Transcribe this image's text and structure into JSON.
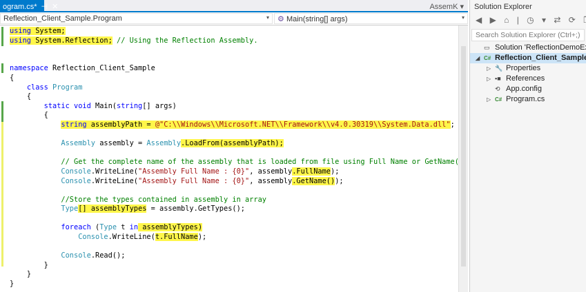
{
  "tab": {
    "title": "ogram.cs*",
    "pin": "⊣",
    "close": "✕",
    "overflow_label": "AssemK ▾"
  },
  "nav": {
    "type_combo": "Reflection_Client_Sample.Program",
    "member_combo": "Main(string[] args)",
    "arrow": "▾",
    "member_icon": "⚙"
  },
  "code": [
    {
      "i": 0,
      "s": [
        {
          "t": "using",
          "c": "kw",
          "h": 1
        },
        {
          "t": " System;",
          "c": "pl",
          "h": 1
        }
      ]
    },
    {
      "i": 0,
      "s": [
        {
          "t": "using",
          "c": "kw",
          "h": 1
        },
        {
          "t": " System.Reflection;",
          "c": "pl",
          "h": 1
        },
        {
          "t": " // Using the Reflection Assembly.",
          "c": "cm"
        }
      ]
    },
    {
      "i": 0,
      "s": []
    },
    {
      "i": 0,
      "s": []
    },
    {
      "i": 0,
      "s": [
        {
          "t": "namespace",
          "c": "kw"
        },
        {
          "t": " Reflection_Client_Sample",
          "c": "pl"
        }
      ]
    },
    {
      "i": 0,
      "s": [
        {
          "t": "{",
          "c": "pl"
        }
      ]
    },
    {
      "i": 4,
      "s": [
        {
          "t": "class",
          "c": "kw"
        },
        {
          "t": " Program",
          "c": "ty"
        }
      ]
    },
    {
      "i": 4,
      "s": [
        {
          "t": "{",
          "c": "pl"
        }
      ]
    },
    {
      "i": 8,
      "s": [
        {
          "t": "static void",
          "c": "kw"
        },
        {
          "t": " Main(",
          "c": "pl"
        },
        {
          "t": "string",
          "c": "kw"
        },
        {
          "t": "[] args)",
          "c": "pl"
        }
      ]
    },
    {
      "i": 8,
      "s": [
        {
          "t": "{",
          "c": "pl"
        }
      ]
    },
    {
      "i": 12,
      "s": [
        {
          "t": "string",
          "c": "kw",
          "h": 1
        },
        {
          "t": " assemblyPath = ",
          "c": "pl",
          "h": 1
        },
        {
          "t": "@\"C:\\\\Windows\\\\Microsoft.NET\\\\Framework\\\\v4.0.30319\\\\System.Data.dll\"",
          "c": "st",
          "h": 1
        },
        {
          "t": ";",
          "c": "pl"
        }
      ]
    },
    {
      "i": 0,
      "s": []
    },
    {
      "i": 12,
      "s": [
        {
          "t": "Assembly",
          "c": "ty"
        },
        {
          "t": " assembly = ",
          "c": "pl"
        },
        {
          "t": "Assembly",
          "c": "ty"
        },
        {
          "t": ".LoadFrom(assemblyPath);",
          "c": "pl",
          "h": 1
        }
      ]
    },
    {
      "i": 0,
      "s": []
    },
    {
      "i": 12,
      "s": [
        {
          "t": "// Get the complete name of the assembly that is loaded from file using Full Name or GetName()",
          "c": "cm"
        }
      ]
    },
    {
      "i": 12,
      "s": [
        {
          "t": "Console",
          "c": "ty"
        },
        {
          "t": ".WriteLine(",
          "c": "pl"
        },
        {
          "t": "\"Assembly Full Name : {0}\"",
          "c": "st"
        },
        {
          "t": ", assembly",
          "c": "pl"
        },
        {
          "t": ".FullName",
          "c": "pl",
          "h": 1
        },
        {
          "t": ");",
          "c": "pl"
        }
      ]
    },
    {
      "i": 12,
      "s": [
        {
          "t": "Console",
          "c": "ty"
        },
        {
          "t": ".WriteLine(",
          "c": "pl"
        },
        {
          "t": "\"Assembly Full Name : {0}\"",
          "c": "st"
        },
        {
          "t": ", assembly",
          "c": "pl"
        },
        {
          "t": ".GetName()",
          "c": "pl",
          "h": 1
        },
        {
          "t": ");",
          "c": "pl"
        }
      ]
    },
    {
      "i": 0,
      "s": []
    },
    {
      "i": 12,
      "s": [
        {
          "t": "//Store the types contained in assembly in array",
          "c": "cm"
        }
      ]
    },
    {
      "i": 12,
      "s": [
        {
          "t": "Type",
          "c": "ty"
        },
        {
          "t": "[] assemblyTypes",
          "c": "pl",
          "h": 1
        },
        {
          "t": " = assembly.GetTypes();",
          "c": "pl"
        }
      ]
    },
    {
      "i": 0,
      "s": []
    },
    {
      "i": 12,
      "s": [
        {
          "t": "foreach",
          "c": "kw"
        },
        {
          "t": " (",
          "c": "pl"
        },
        {
          "t": "Type",
          "c": "ty"
        },
        {
          "t": " t ",
          "c": "pl"
        },
        {
          "t": "in",
          "c": "kw"
        },
        {
          "t": " assemblyTypes)",
          "c": "pl",
          "h": 1
        }
      ]
    },
    {
      "i": 16,
      "s": [
        {
          "t": "Console",
          "c": "ty"
        },
        {
          "t": ".WriteLine(",
          "c": "pl"
        },
        {
          "t": "t.FullName",
          "c": "pl",
          "h": 1
        },
        {
          "t": ");",
          "c": "pl"
        }
      ]
    },
    {
      "i": 0,
      "s": []
    },
    {
      "i": 12,
      "s": [
        {
          "t": "Console",
          "c": "ty"
        },
        {
          "t": ".Read();",
          "c": "pl"
        }
      ]
    },
    {
      "i": 8,
      "s": [
        {
          "t": "}",
          "c": "pl"
        }
      ]
    },
    {
      "i": 4,
      "s": [
        {
          "t": "}",
          "c": "pl"
        }
      ]
    },
    {
      "i": 0,
      "s": [
        {
          "t": "}",
          "c": "pl"
        }
      ]
    }
  ],
  "solution_explorer": {
    "title": "Solution Explorer",
    "toolbar": "◀ ▶ ⌂ | ◷ ▾ ⇄ ⟳ ❐ ▣",
    "search_placeholder": "Search Solution Explorer (Ctrl+;)",
    "items": [
      {
        "label": "Solution 'ReflectionDemoExam",
        "icon": "▭",
        "exp": ""
      },
      {
        "label": "Reflection_Client_Sample",
        "icon": "C#",
        "exp": "◢"
      },
      {
        "label": "Properties",
        "icon": "🔧",
        "exp": "▷"
      },
      {
        "label": "References",
        "icon": "▪■",
        "exp": "▷"
      },
      {
        "label": "App.config",
        "icon": "⟲",
        "exp": ""
      },
      {
        "label": "Program.cs",
        "icon": "C#",
        "exp": "▷"
      }
    ]
  }
}
